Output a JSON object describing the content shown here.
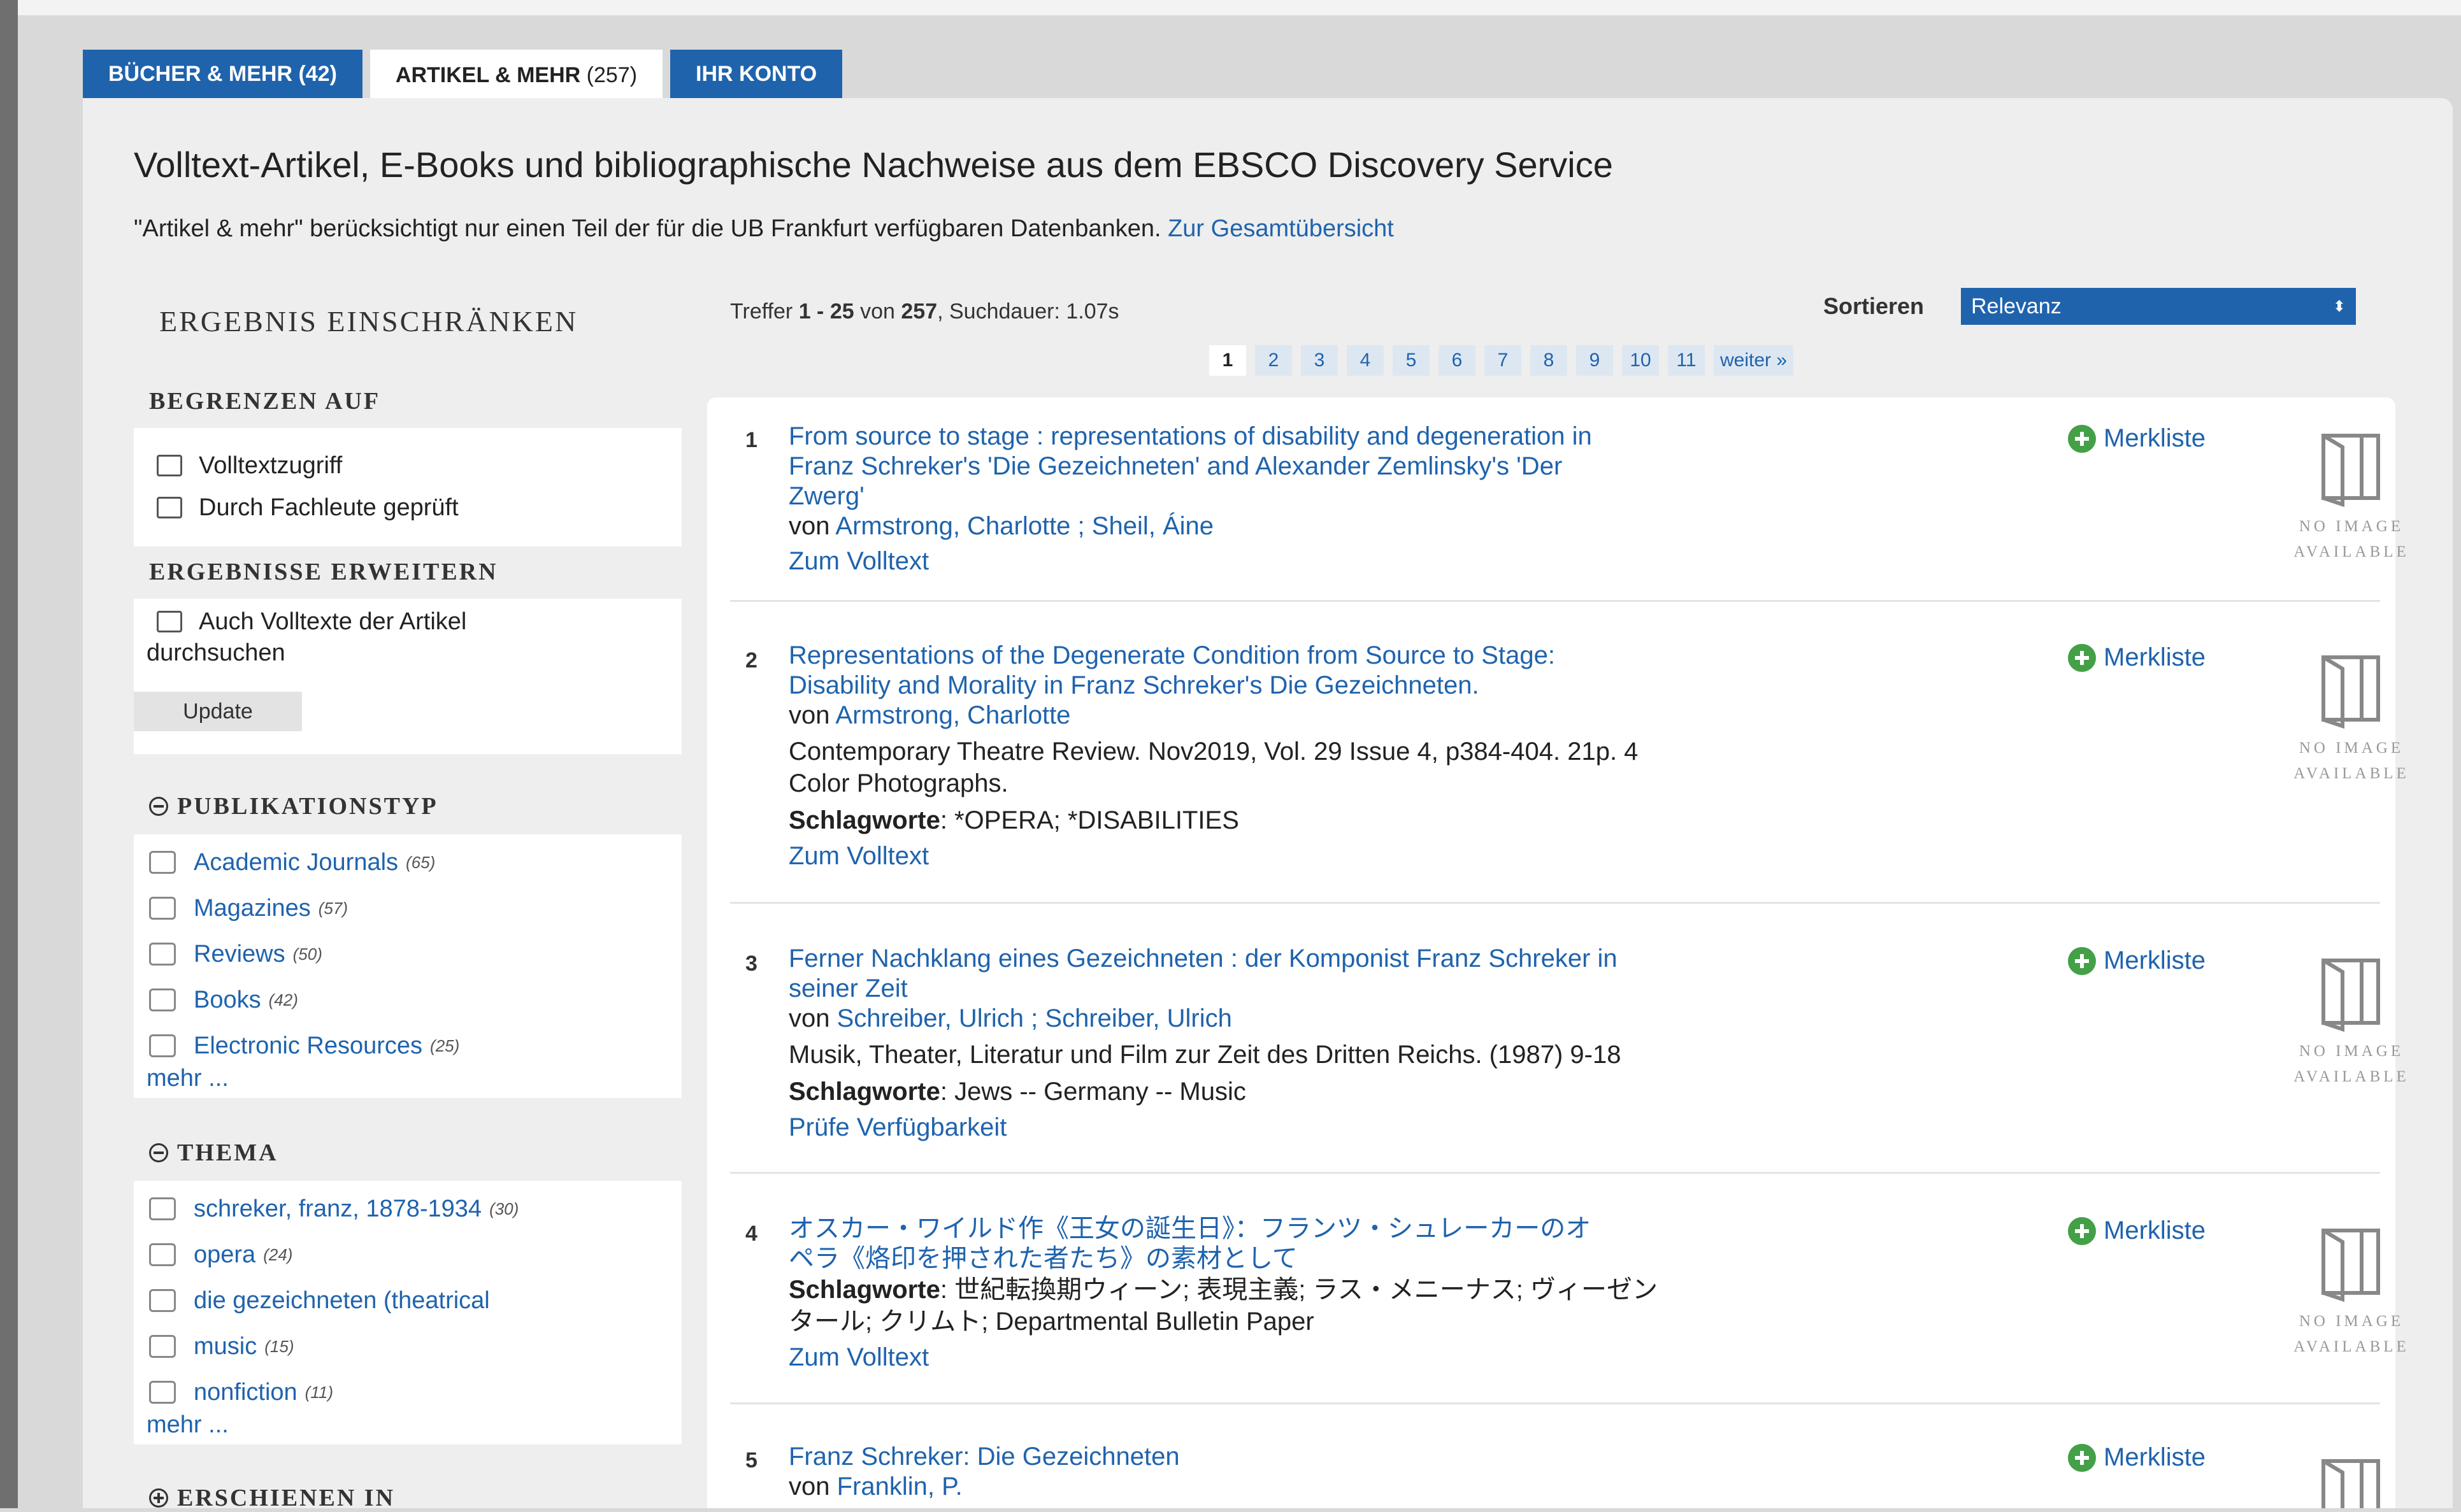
{
  "tabs": [
    {
      "label": "BÜCHER & MEHR",
      "count": "(42)"
    },
    {
      "label": "ARTIKEL & MEHR",
      "count": "(257)"
    },
    {
      "label": "IHR KONTO",
      "count": ""
    }
  ],
  "heading": "Volltext-Artikel, E-Books und bibliographische Nachweise aus dem EBSCO Discovery Service",
  "intro": {
    "text": "\"Artikel & mehr\" berücksichtigt nur einen Teil der für die UB Frankfurt verfügbaren Datenbanken.",
    "link": "Zur Gesamtübersicht"
  },
  "sidebar": {
    "title": "ERGEBNIS EINSCHRÄNKEN",
    "limit_title": "BEGRENZEN AUF",
    "limit_options": [
      "Volltextzugriff",
      "Durch Fachleute geprüft"
    ],
    "expand_title": "ERGEBNISSE ERWEITERN",
    "expand_option_line1": "Auch Volltexte der Artikel",
    "expand_option_line2": "durchsuchen",
    "update_label": "Update",
    "pubtype_title": "PUBLIKATIONSTYP",
    "pubtypes": [
      {
        "label": "Academic Journals",
        "count": "(65)"
      },
      {
        "label": "Magazines",
        "count": "(57)"
      },
      {
        "label": "Reviews",
        "count": "(50)"
      },
      {
        "label": "Books",
        "count": "(42)"
      },
      {
        "label": "Electronic Resources",
        "count": "(25)"
      }
    ],
    "more_label": "mehr ...",
    "topic_title": "THEMA",
    "topics": [
      {
        "label": "schreker, franz, 1878-1934",
        "count": "(30)"
      },
      {
        "label": "opera",
        "count": "(24)"
      },
      {
        "label": "die gezeichneten (theatrical",
        "count": ""
      },
      {
        "label": "music",
        "count": "(15)"
      },
      {
        "label": "nonfiction",
        "count": "(11)"
      }
    ],
    "published_title": "ERSCHIENEN IN"
  },
  "results_header": {
    "hits_prefix": "Treffer ",
    "hits_range": "1 - 25",
    "hits_mid": " von ",
    "hits_total": "257",
    "hits_suffix": ", Suchdauer: 1.07s",
    "sort_label": "Sortieren",
    "sort_value": "Relevanz",
    "sort_arrow": "⬍"
  },
  "pagination": {
    "pages": [
      "1",
      "2",
      "3",
      "4",
      "5",
      "6",
      "7",
      "8",
      "9",
      "10",
      "11"
    ],
    "next_label": "weiter »"
  },
  "merkliste_label": "Merkliste",
  "no_image": {
    "line1": "NO IMAGE",
    "line2": "AVAILABLE"
  },
  "results": [
    {
      "num": "1",
      "title_lines": [
        "From source to stage : representations of disability and degeneration in",
        "Franz Schreker's 'Die Gezeichneten' and Alexander Zemlinsky's 'Der",
        "Zwerg'"
      ],
      "by_prefix": "von ",
      "authors": "Armstrong, Charlotte ; Sheil, Áine",
      "link": "Zum Volltext"
    },
    {
      "num": "2",
      "title_lines": [
        "Representations of the Degenerate Condition from Source to Stage:",
        "Disability and Morality in Franz Schreker's Die Gezeichneten."
      ],
      "by_prefix": "von ",
      "authors": "Armstrong, Charlotte",
      "source_lines": [
        "Contemporary Theatre Review. Nov2019, Vol. 29 Issue 4, p384-404. 21p. 4",
        "Color Photographs."
      ],
      "subject_label": "Schlagworte",
      "subjects": ": *OPERA; *DISABILITIES",
      "link": "Zum Volltext"
    },
    {
      "num": "3",
      "title_lines": [
        "Ferner Nachklang eines Gezeichneten : der Komponist Franz Schreker in",
        "seiner Zeit"
      ],
      "by_prefix": "von ",
      "authors": "Schreiber, Ulrich ; Schreiber, Ulrich",
      "source_lines": [
        "Musik, Theater, Literatur und Film zur Zeit des Dritten Reichs. (1987) 9-18"
      ],
      "subject_label": "Schlagworte",
      "subjects": ": Jews -- Germany -- Music",
      "link": "Prüfe Verfügbarkeit"
    },
    {
      "num": "4",
      "title_lines": [
        "オスカー・ワイルド作《王女の誕生日》：フランツ・シュレーカーのオ",
        "ペラ《烙印を押された者たち》の素材として"
      ],
      "subject_label": "Schlagworte",
      "subject_lines": [
        ": 世紀転換期ウィーン; 表現主義; ラス・メニーナス; ヴィーゼン",
        "タール; クリムト; Departmental Bulletin Paper"
      ],
      "link": "Zum Volltext"
    },
    {
      "num": "5",
      "title_lines": [
        "Franz Schreker: Die Gezeichneten"
      ],
      "by_prefix": "von ",
      "authors": "Franklin, P."
    }
  ],
  "colors": {
    "accent": "#1f63ad",
    "background": "#eeeeee",
    "add_icon": "#43a047"
  }
}
